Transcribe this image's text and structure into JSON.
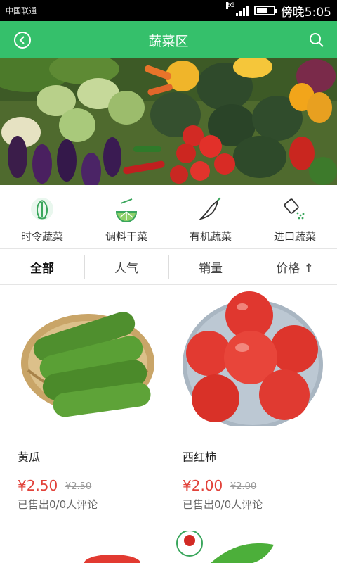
{
  "status_bar": {
    "carrier": "中国联通",
    "network": "2G",
    "time": "傍晚5:05",
    "battery_level": 0.7
  },
  "header": {
    "title": "蔬菜区",
    "back_icon": "back-icon",
    "search_icon": "search-icon"
  },
  "banner": {
    "image": "vegetable-banner"
  },
  "categories": [
    {
      "label": "时令蔬菜",
      "icon": "cabbage-icon"
    },
    {
      "label": "调料干菜",
      "icon": "lime-slice-icon"
    },
    {
      "label": "有机蔬菜",
      "icon": "chili-icon"
    },
    {
      "label": "进口蔬菜",
      "icon": "salt-shaker-icon"
    }
  ],
  "sort_tabs": [
    {
      "label": "全部",
      "active": true
    },
    {
      "label": "人气",
      "active": false
    },
    {
      "label": "销量",
      "active": false
    },
    {
      "label": "价格 ↑",
      "active": false
    }
  ],
  "products": [
    {
      "name": "黄瓜",
      "price": "¥2.50",
      "original_price": "¥2.50",
      "sold": "已售出0/0人评论",
      "image": "cucumber-image"
    },
    {
      "name": "西红柿",
      "price": "¥2.00",
      "original_price": "¥2.00",
      "sold": "已售出0/0人评论",
      "image": "tomato-image"
    }
  ],
  "colors": {
    "accent": "#35c06b",
    "price": "#e2423a"
  }
}
